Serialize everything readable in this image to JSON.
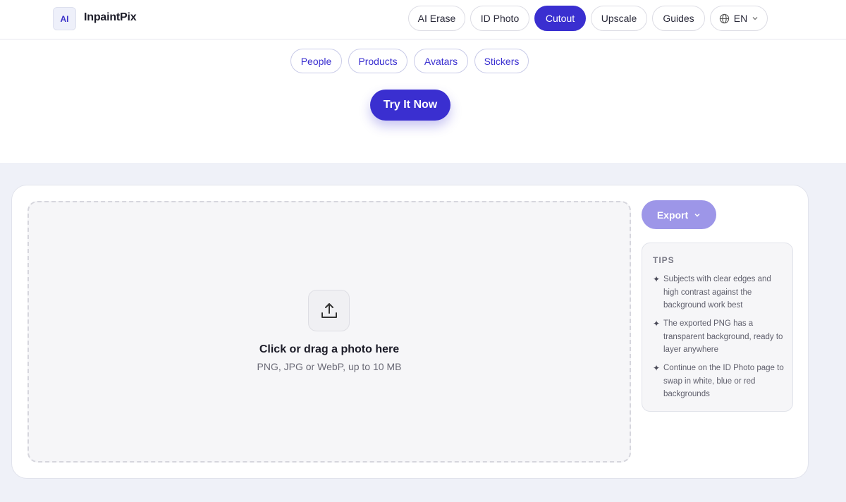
{
  "brand": {
    "badge": "AI",
    "name": "InpaintPix"
  },
  "nav": {
    "items": [
      {
        "label": "AI Erase",
        "active": false
      },
      {
        "label": "ID Photo",
        "active": false
      },
      {
        "label": "Cutout",
        "active": true
      },
      {
        "label": "Upscale",
        "active": false
      },
      {
        "label": "Guides",
        "active": false
      }
    ],
    "language": {
      "label": "EN",
      "icon": "globe-icon",
      "chevron": "chevron-down-icon"
    }
  },
  "categories": [
    "People",
    "Products",
    "Avatars",
    "Stickers"
  ],
  "cta": {
    "label": "Try It Now"
  },
  "dropzone": {
    "icon": "upload-icon",
    "title": "Click or drag a photo here",
    "subtitle": "PNG, JPG or WebP, up to 10 MB"
  },
  "export": {
    "label": "Export",
    "icon": "chevron-down-icon"
  },
  "tips": {
    "title": "TIPS",
    "bullet": "✦",
    "items": [
      "Subjects with clear edges and high contrast against the background work best",
      "The exported PNG has a transparent background, ready to layer anywhere",
      "Continue on the ID Photo page to swap in white, blue or red backgrounds"
    ]
  },
  "colors": {
    "accent": "#3a2fd0",
    "accent_soft": "#9d96e8",
    "band_bg": "#eff1f8",
    "dropzone_bg": "#f6f6f8"
  }
}
